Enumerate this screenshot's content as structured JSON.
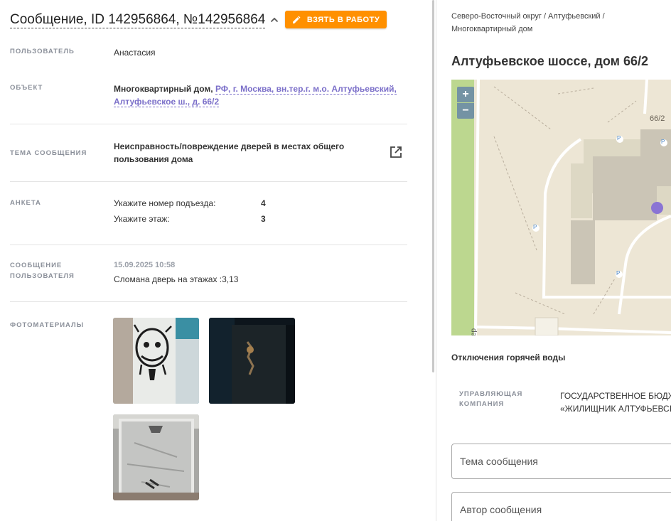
{
  "header": {
    "title": "Сообщение, ID 142956864, №142956864",
    "take_button": "ВЗЯТЬ В РАБОТУ"
  },
  "details": {
    "user_label": "ПОЛЬЗОВАТЕЛЬ",
    "user_value": "Анастасия",
    "object_label": "ОБЪЕКТ",
    "object_type": "Многоквартирный дом,",
    "object_addr_1": "РФ, г. Москва, вн.тер.г. м.о. Алтуфьевский,",
    "object_addr_2": "Алтуфьевское ш., д. 66/2",
    "topic_label": "ТЕМА СООБЩЕНИЯ",
    "topic_1": "Неисправность/повреждение дверей в местах общего",
    "topic_2": "пользования дома",
    "survey_label": "АНКЕТА",
    "survey": [
      {
        "q": "Укажите номер подъезда:",
        "a": "4"
      },
      {
        "q": "Укажите этаж:",
        "a": "3"
      }
    ],
    "msg_label_1": "СООБЩЕНИЕ",
    "msg_label_2": "ПОЛЬЗОВАТЕЛЯ",
    "msg_date": "15.09.2025 10:58",
    "msg_text": "Сломана дверь на этажах :3,13",
    "photos_label": "ФОТОМАТЕРИАЛЫ"
  },
  "right": {
    "breadcrumb_1": "Северо-Восточный округ / Алтуфьевский /",
    "breadcrumb_2": "Многоквартирный дом",
    "address_title": "Алтуфьевское шоссе, дом 66/2",
    "map": {
      "zoom_in": "+",
      "zoom_out": "−",
      "building_label": "66/2",
      "parking_glyph": "P",
      "road_fragment": "ер"
    },
    "hot_water_title": "Отключения горячей воды",
    "mc_label_1": "УПРАВЛЯЮЩАЯ",
    "mc_label_2": "КОМПАНИЯ",
    "mc_value_1": "ГОСУДАРСТВЕННОЕ БЮДЖ",
    "mc_value_2": "«ЖИЛИЩНИК АЛТУФЬЕВСІ",
    "field_topic_placeholder": "Тема сообщения",
    "field_author_placeholder": "Автор сообщения"
  },
  "colors": {
    "accent_orange": "#ff9000",
    "link_purple": "#7b6fc9",
    "marker_purple": "#8a74d4"
  }
}
